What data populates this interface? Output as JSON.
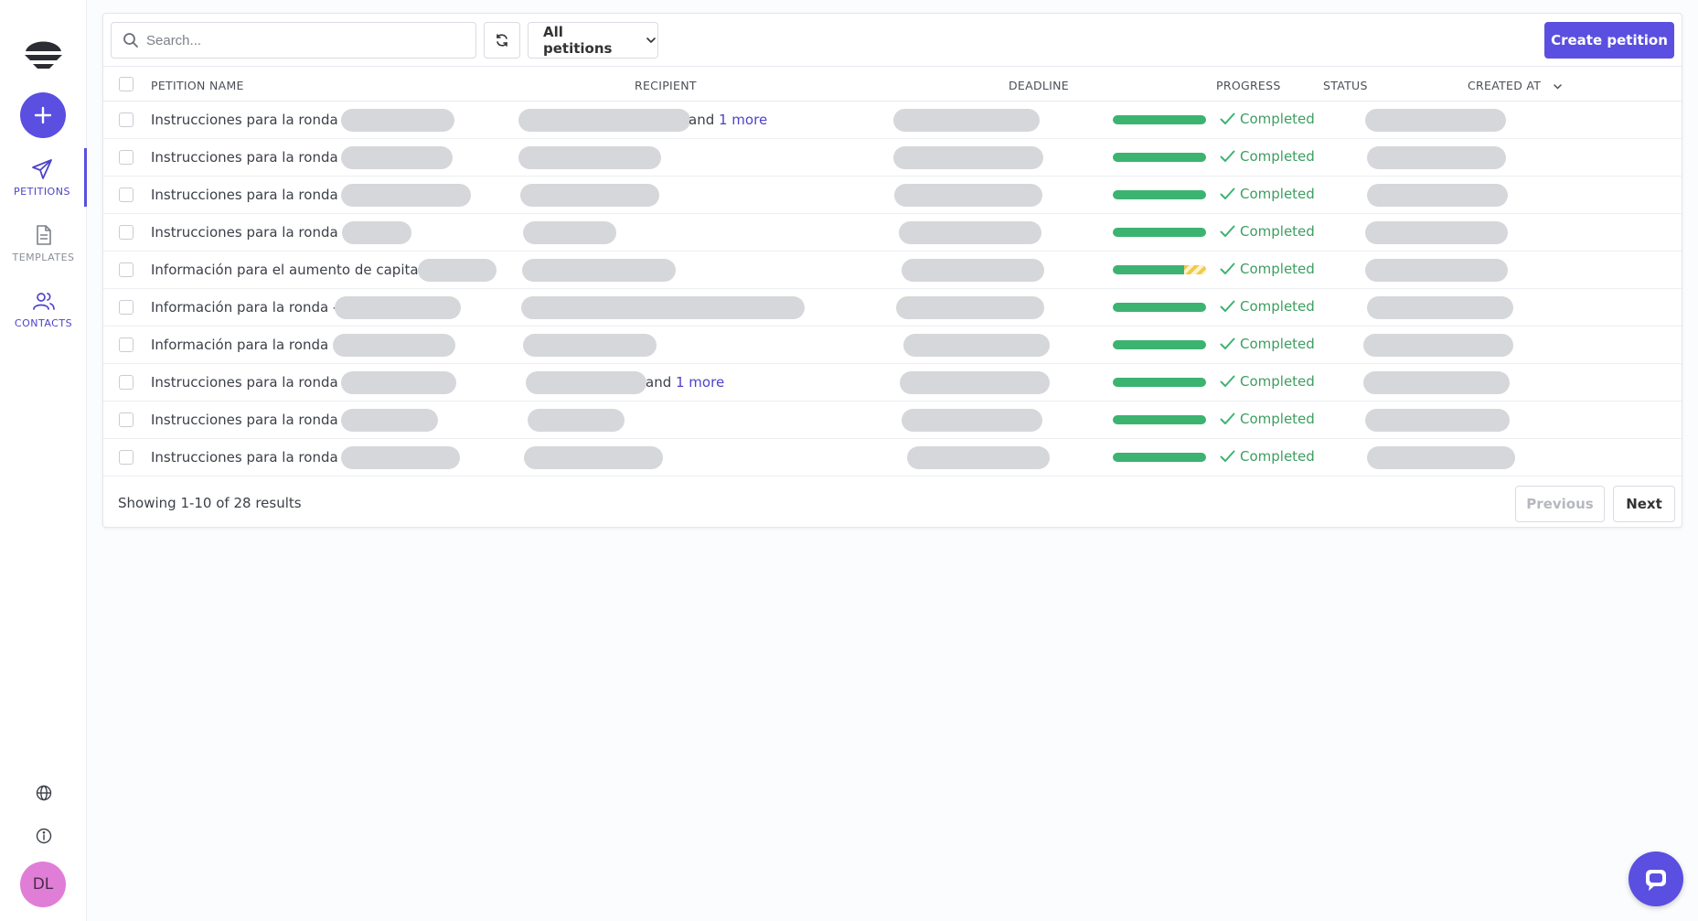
{
  "sidebar": {
    "nav": [
      {
        "label": "PETITIONS",
        "icon": "paper-plane-icon",
        "active": true
      },
      {
        "label": "TEMPLATES",
        "icon": "document-icon",
        "active": false
      },
      {
        "label": "CONTACTS",
        "icon": "users-icon",
        "active": false
      }
    ],
    "avatar_initials": "DL"
  },
  "toolbar": {
    "search_placeholder": "Search...",
    "filter_label": "All petitions",
    "create_label": "Create petition"
  },
  "table": {
    "headers": {
      "name": "PETITION NAME",
      "recipient": "RECIPIENT",
      "deadline": "DEADLINE",
      "progress": "PROGRESS",
      "status": "STATUS",
      "created": "CREATED AT"
    },
    "rows": [
      {
        "name": "Instrucciones para la ronda -",
        "recipient_suffix": "and ",
        "recipient_more": "1 more",
        "status": "Completed",
        "progress": 100
      },
      {
        "name": "Instrucciones para la ronda -",
        "recipient_suffix": "",
        "recipient_more": "",
        "status": "Completed",
        "progress": 100
      },
      {
        "name": "Instrucciones para la ronda -",
        "recipient_suffix": "",
        "recipient_more": "",
        "status": "Completed",
        "progress": 100
      },
      {
        "name": "Instrucciones para la ronda -",
        "recipient_suffix": "",
        "recipient_more": "",
        "status": "Completed",
        "progress": 100
      },
      {
        "name": "Información para el aumento de capital -",
        "recipient_suffix": "",
        "recipient_more": "",
        "status": "Completed",
        "progress": 76
      },
      {
        "name": "Información para la ronda -",
        "recipient_suffix": "",
        "recipient_more": "",
        "status": "Completed",
        "progress": 100
      },
      {
        "name": "Información para la ronda -",
        "recipient_suffix": "",
        "recipient_more": "",
        "status": "Completed",
        "progress": 100
      },
      {
        "name": "Instrucciones para la ronda -",
        "recipient_suffix": "and ",
        "recipient_more": "1 more",
        "status": "Completed",
        "progress": 100
      },
      {
        "name": "Instrucciones para la ronda -",
        "recipient_suffix": "",
        "recipient_more": "",
        "status": "Completed",
        "progress": 100
      },
      {
        "name": "Instrucciones para la ronda -",
        "recipient_suffix": "",
        "recipient_more": "",
        "status": "Completed",
        "progress": 100
      }
    ]
  },
  "pagination": {
    "summary": "Showing 1-10 of 28 results",
    "previous": "Previous",
    "next": "Next"
  },
  "colors": {
    "accent": "#5a4fe0",
    "progress": "#3cb371",
    "status_completed": "#3c9e5f",
    "avatar": "#e07ed7"
  }
}
